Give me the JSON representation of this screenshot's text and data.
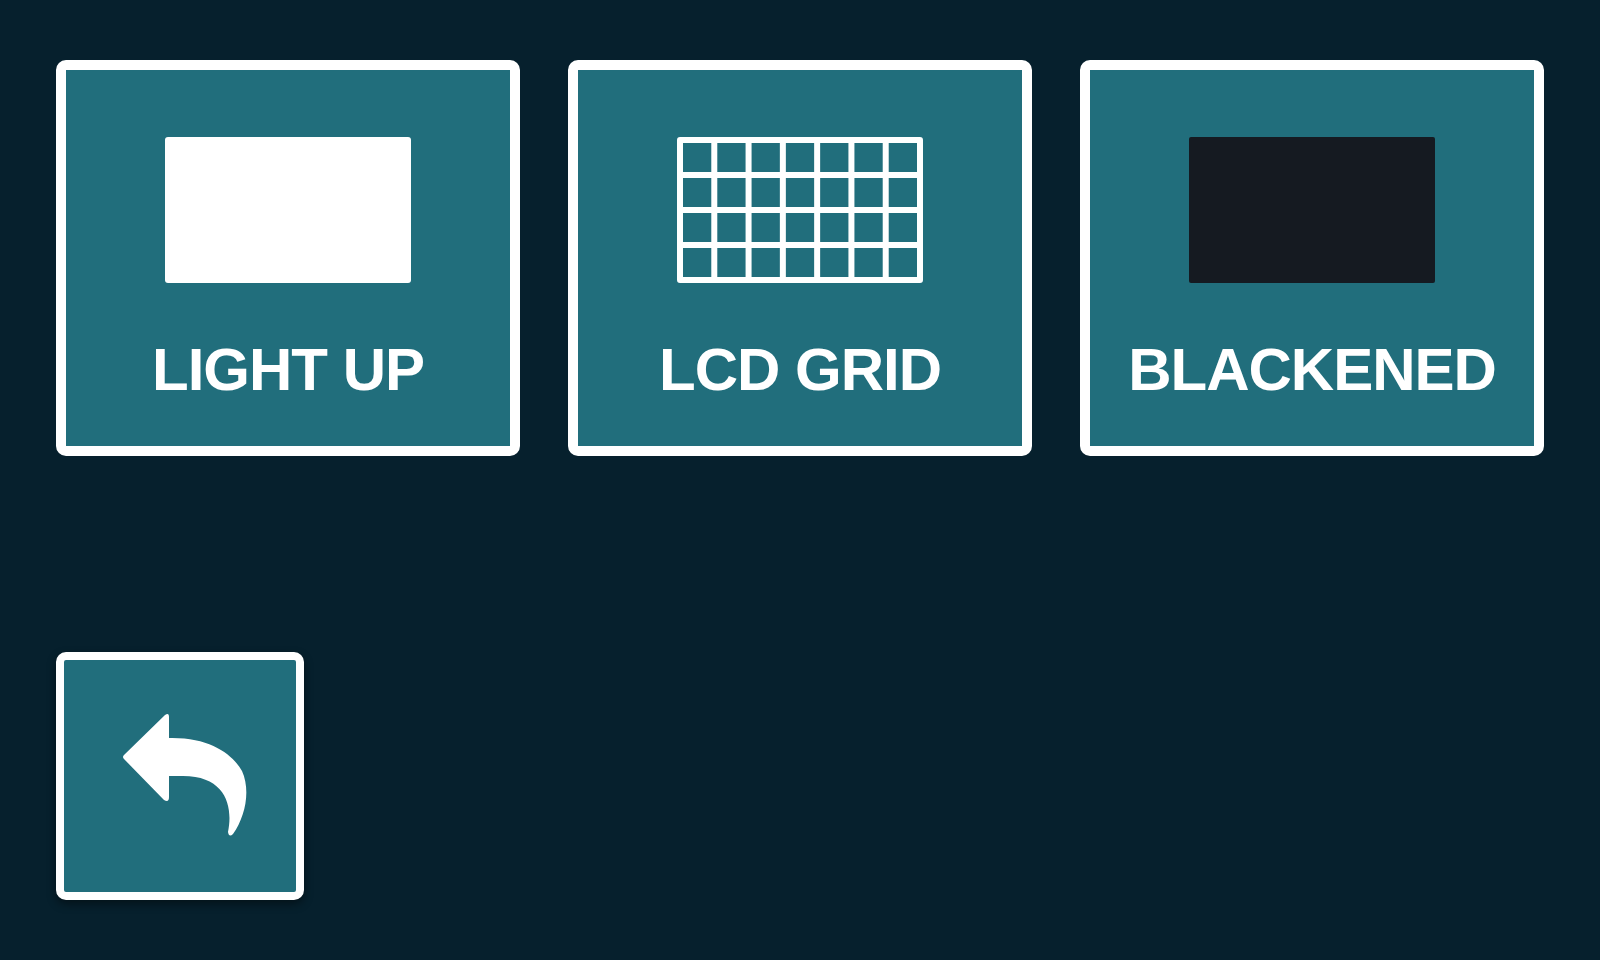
{
  "modes": [
    {
      "kind": "light",
      "label": "LIGHT UP"
    },
    {
      "kind": "grid",
      "label": "LCD GRID"
    },
    {
      "kind": "black",
      "label": "BLACKENED"
    }
  ]
}
